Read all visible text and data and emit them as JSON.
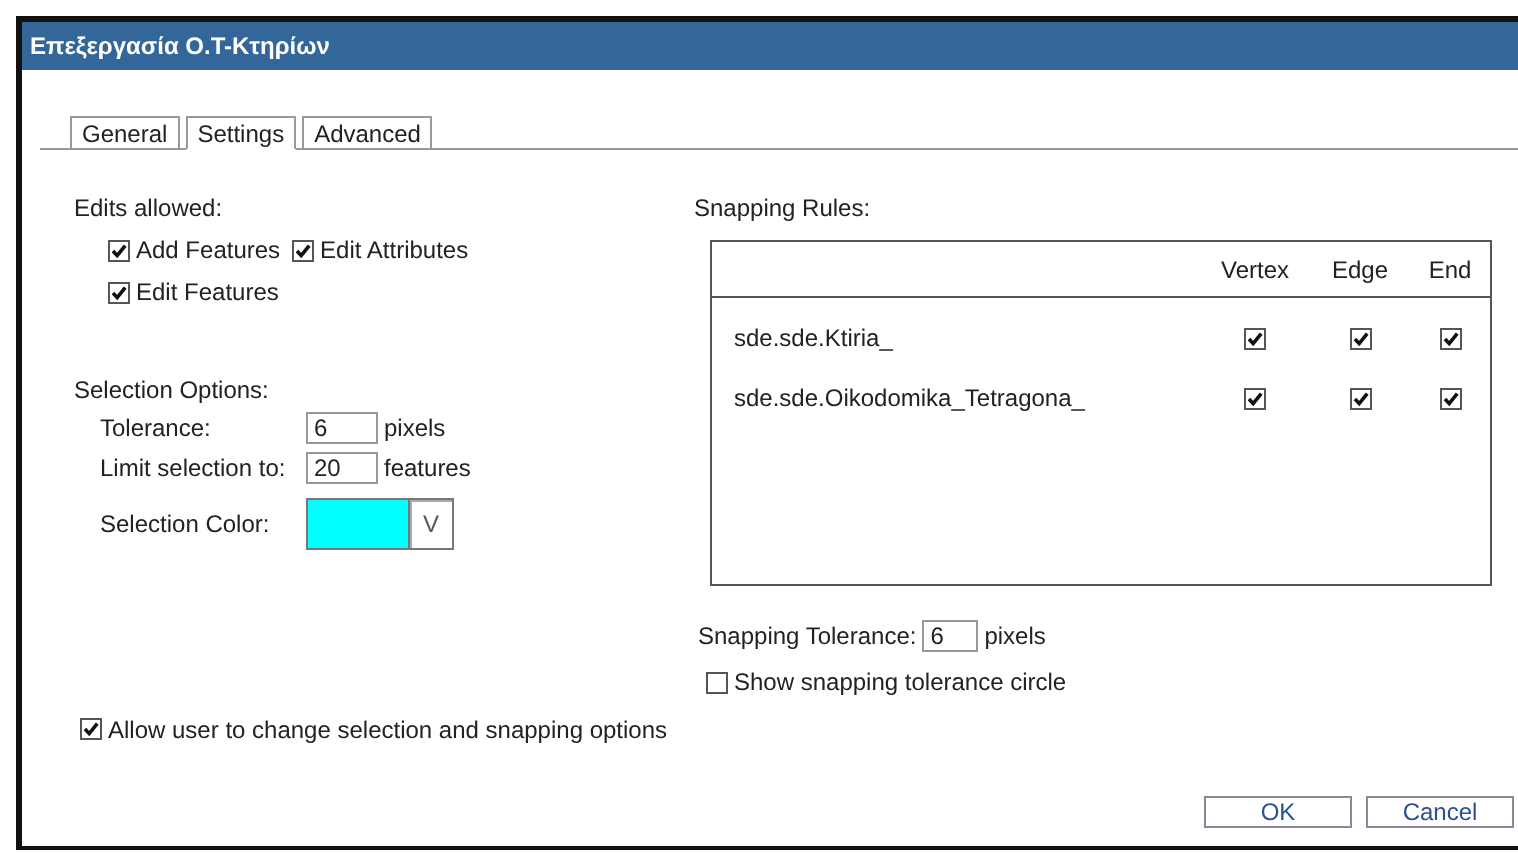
{
  "window": {
    "title": "Επεξεργασία Ο.Τ-Κτηρίων"
  },
  "tabs": [
    {
      "label": "General",
      "selected": false
    },
    {
      "label": "Settings",
      "selected": true
    },
    {
      "label": "Advanced",
      "selected": false
    }
  ],
  "edits_allowed": {
    "label": "Edits allowed:",
    "options": [
      {
        "label": "Add Features",
        "checked": true
      },
      {
        "label": "Edit Attributes",
        "checked": true
      },
      {
        "label": "Edit Features",
        "checked": true
      }
    ]
  },
  "selection_options": {
    "label": "Selection Options:",
    "fields": [
      {
        "label": "Tolerance:",
        "value": "6",
        "unit": "pixels"
      },
      {
        "label": "Limit selection to:",
        "value": "20",
        "unit": "features"
      }
    ],
    "color_picker": {
      "label": "Selection Color:",
      "color": "#00ffff",
      "dropdown": "V"
    }
  },
  "snapping_rules": {
    "label": "Snapping Rules:",
    "columns": [
      "Vertex",
      "Edge",
      "End"
    ],
    "rows": [
      {
        "name": "sde.sde.Ktiria_",
        "cells": [
          {
            "checked": true
          },
          {
            "checked": true
          },
          {
            "checked": true
          }
        ]
      },
      {
        "name": "sde.sde.Oikodomika_Tetragona_",
        "cells": [
          {
            "checked": true
          },
          {
            "checked": true
          },
          {
            "checked": true
          }
        ]
      }
    ]
  },
  "snapping_tolerance": {
    "label": "Snapping Tolerance:",
    "value": "6",
    "unit": "pixels"
  },
  "show_circle": {
    "label": "Show snapping tolerance circle",
    "checked": false
  },
  "allow_user": {
    "label": "Allow user to change selection and snapping options",
    "checked": true
  },
  "buttons": [
    "OK",
    "Cancel"
  ]
}
